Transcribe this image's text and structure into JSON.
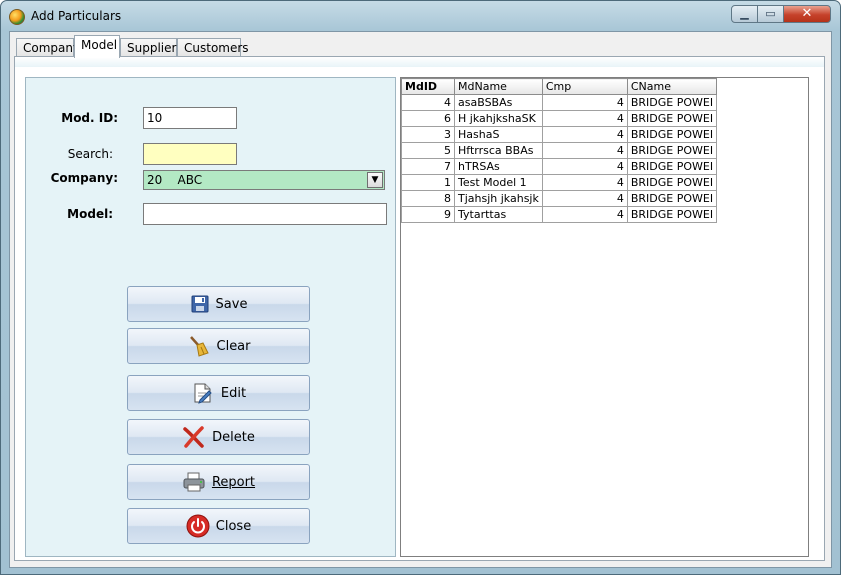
{
  "window": {
    "title": "Add Particulars"
  },
  "tabs": [
    {
      "label": "Company"
    },
    {
      "label": "Model"
    },
    {
      "label": "Suppliers"
    },
    {
      "label": "Customers"
    }
  ],
  "active_tab": "Model",
  "form": {
    "mod_id_label": "Mod. ID:",
    "mod_id_value": "10",
    "search_label": "Search:",
    "search_value": "",
    "company_label": "Company:",
    "company_value": "20    ABC",
    "model_label": "Model:",
    "model_value": ""
  },
  "buttons": {
    "save": "Save",
    "clear": "Clear",
    "edit": "Edit",
    "delete": "Delete",
    "report": "Report",
    "close": "Close"
  },
  "grid": {
    "columns": [
      "MdID",
      "MdName",
      "Cmp",
      "CName"
    ],
    "rows": [
      [
        "4",
        "asaBSBAs",
        "4",
        "BRIDGE POWEI"
      ],
      [
        "6",
        "H jkahjkshaSK",
        "4",
        "BRIDGE POWEI"
      ],
      [
        "3",
        "HashaS",
        "4",
        "BRIDGE POWEI"
      ],
      [
        "5",
        "Hftrrsca BBAs",
        "4",
        "BRIDGE POWEI"
      ],
      [
        "7",
        "hTRSAs",
        "4",
        "BRIDGE POWEI"
      ],
      [
        "1",
        "Test Model 1",
        "4",
        "BRIDGE POWEI"
      ],
      [
        "8",
        "Tjahsjh jkahsjk",
        "4",
        "BRIDGE POWEI"
      ],
      [
        "9",
        "Tytarttas",
        "4",
        "BRIDGE POWEI"
      ]
    ]
  },
  "colors": {
    "search_bg": "#ffffc0",
    "company_bg": "#b3e8c4",
    "panel_bg": "#e5f3f7"
  }
}
